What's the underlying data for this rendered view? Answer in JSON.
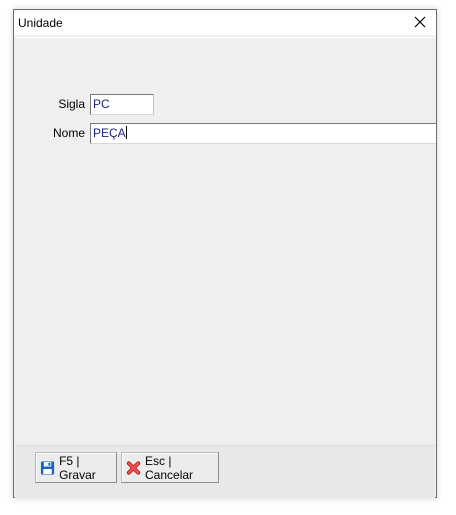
{
  "window": {
    "title": "Unidade"
  },
  "form": {
    "sigla_label": "Sigla",
    "sigla_value": "PC",
    "nome_label": "Nome",
    "nome_value": "PEÇA"
  },
  "footer": {
    "save_label": "F5 | Gravar",
    "cancel_label": "Esc | Cancelar"
  },
  "icons": {
    "save": "floppy-disk-icon",
    "cancel": "red-x-icon",
    "close": "close-icon"
  },
  "colors": {
    "field_text": "#1a237e",
    "save_icon": "#1565c0",
    "cancel_icon": "#d32f2f"
  }
}
